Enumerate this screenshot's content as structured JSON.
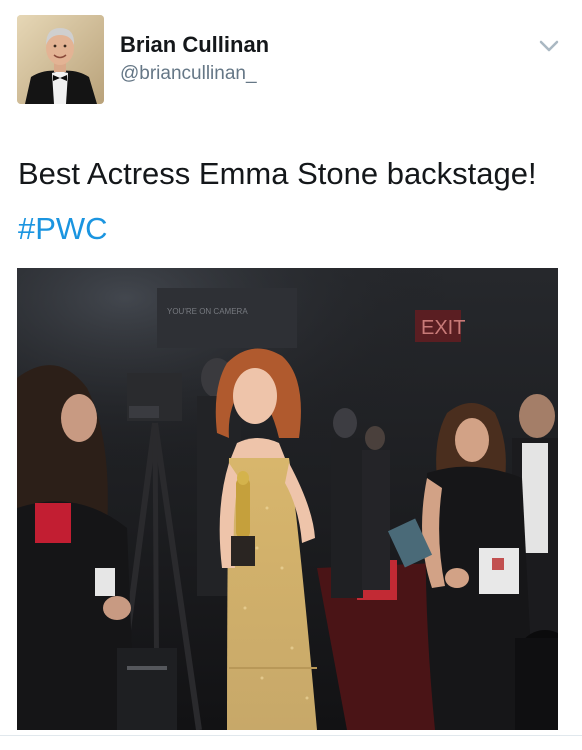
{
  "tweet": {
    "author": {
      "display_name": "Brian Cullinan",
      "handle": "@briancullinan_"
    },
    "text_main": "Best Actress Emma Stone backstage! ",
    "hashtag": "#PWC",
    "colors": {
      "link": "#1b95e0",
      "secondary_text": "#657786",
      "primary_text": "#14171a"
    },
    "icons": {
      "menu": "chevron-down-icon"
    }
  },
  "photo": {
    "signs": {
      "exit": "EXIT",
      "camera_sign": "YOU'RE ON CAMERA"
    }
  }
}
